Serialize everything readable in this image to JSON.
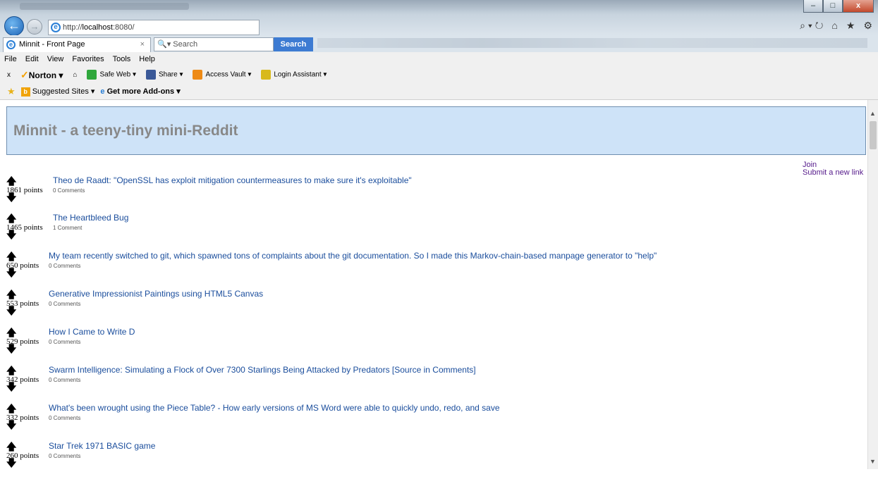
{
  "browser": {
    "url_prefix": "http://",
    "url_host": "localhost",
    "url_suffix": ":8080/",
    "tab_title": "Minnit - Front Page",
    "search_placeholder": "Search",
    "search_button": "Search",
    "back_glyph": "←",
    "forward_glyph": "→",
    "close_glyph": "×",
    "window_buttons": [
      "–",
      "□",
      "x"
    ],
    "right_icons": [
      "⌕ ▾ ↻",
      "⌂",
      "★",
      "⚙"
    ]
  },
  "menu": [
    "File",
    "Edit",
    "View",
    "Favorites",
    "Tools",
    "Help"
  ],
  "norton_toolbar": {
    "close": "x",
    "brand": "Norton ▾",
    "items": [
      "Safe Web ▾",
      "Share ▾",
      "Access Vault ▾",
      "Login Assistant ▾"
    ]
  },
  "favorites_bar": {
    "suggested": "Suggested Sites ▾",
    "addons": "Get more Add-ons ▾"
  },
  "page": {
    "title": "Minnit - a teeny-tiny mini-Reddit",
    "join": "Join",
    "submit": "Submit a new link",
    "upvote_glyph": "🡅",
    "downvote_glyph": "🡇",
    "posts": [
      {
        "points": "1861 points",
        "title": "Theo de Raadt: \"OpenSSL has exploit mitigation countermeasures to make sure it's exploitable\"",
        "comments": "0 Comments"
      },
      {
        "points": "1465 points",
        "title": "The Heartbleed Bug",
        "comments": "1 Comment"
      },
      {
        "points": "650 points",
        "title": "My team recently switched to git, which spawned tons of complaints about the git documentation. So I made this Markov-chain-based manpage generator to \"help\"",
        "comments": "0 Comments"
      },
      {
        "points": "553 points",
        "title": "Generative Impressionist Paintings using HTML5 Canvas",
        "comments": "0 Comments"
      },
      {
        "points": "529 points",
        "title": "How I Came to Write D",
        "comments": "0 Comments"
      },
      {
        "points": "342 points",
        "title": "Swarm Intelligence: Simulating a Flock of Over 7300 Starlings Being Attacked by Predators [Source in Comments]",
        "comments": "0 Comments"
      },
      {
        "points": "332 points",
        "title": "What's been wrought using the Piece Table? - How early versions of MS Word were able to quickly undo, redo, and save",
        "comments": "0 Comments"
      },
      {
        "points": "260 points",
        "title": "Star Trek 1971 BASIC game",
        "comments": "0 Comments"
      }
    ]
  }
}
